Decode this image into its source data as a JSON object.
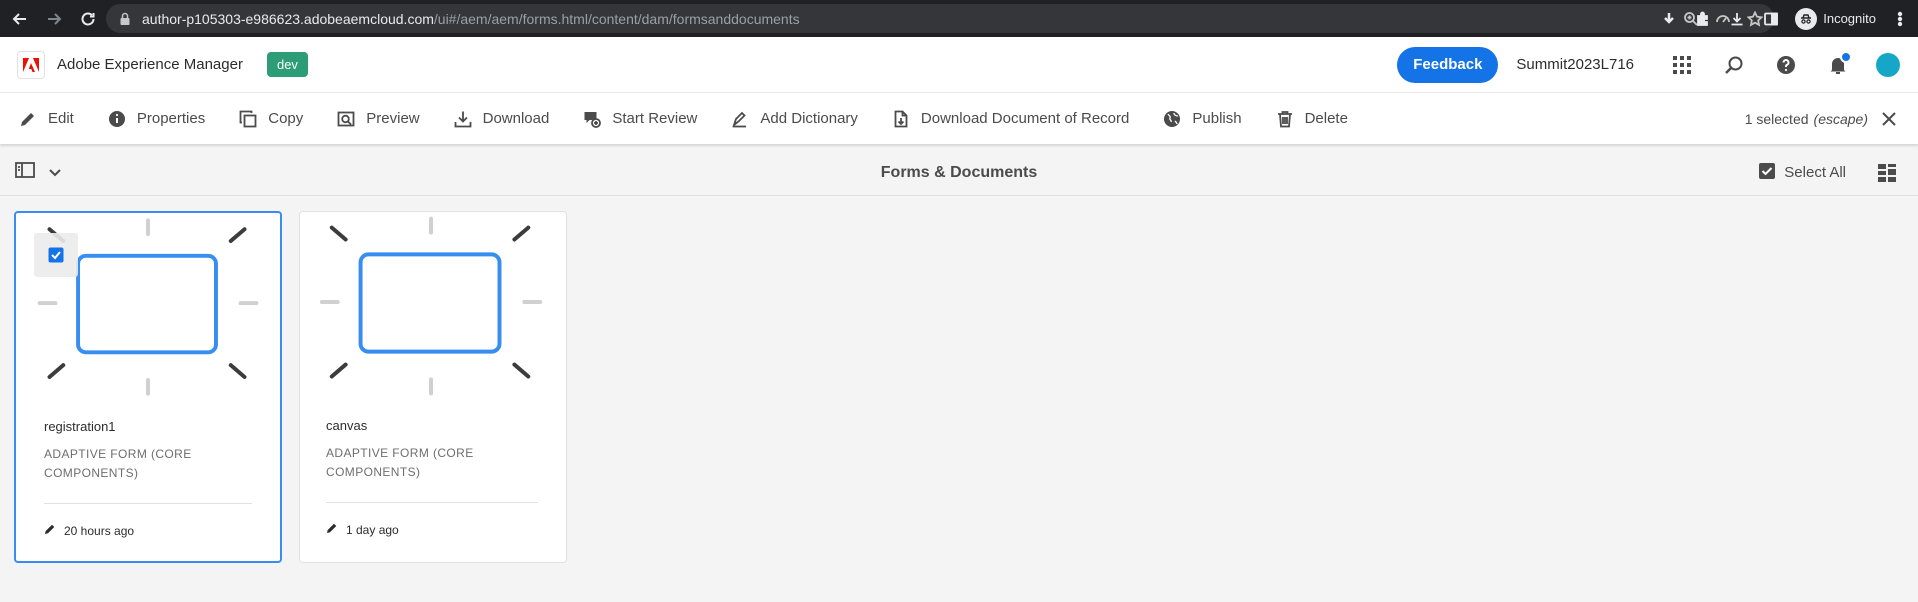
{
  "browser": {
    "url_host": "author-p105303-e986623.adobeaemcloud.com",
    "url_path": "/ui#/aem/aem/forms.html/content/dam/formsanddocuments",
    "profile_label": "Incognito"
  },
  "header": {
    "app_title": "Adobe Experience Manager",
    "env_badge": "dev",
    "feedback_label": "Feedback",
    "org_name": "Summit2023L716"
  },
  "actions": [
    {
      "label": "Edit",
      "icon": "pencil-icon"
    },
    {
      "label": "Properties",
      "icon": "info-icon"
    },
    {
      "label": "Copy",
      "icon": "copy-icon"
    },
    {
      "label": "Preview",
      "icon": "preview-icon"
    },
    {
      "label": "Download",
      "icon": "download-icon"
    },
    {
      "label": "Start Review",
      "icon": "review-icon"
    },
    {
      "label": "Add Dictionary",
      "icon": "dictionary-icon"
    },
    {
      "label": "Download Document of Record",
      "icon": "document-icon"
    },
    {
      "label": "Publish",
      "icon": "globe-icon"
    },
    {
      "label": "Delete",
      "icon": "trash-icon"
    }
  ],
  "selection": {
    "count_label": "1 selected",
    "hint": "(escape)"
  },
  "title_bar": {
    "title": "Forms & Documents",
    "select_all_label": "Select All"
  },
  "cards": [
    {
      "name": "registration1",
      "type": "ADAPTIVE FORM (CORE COMPONENTS)",
      "modified": "20 hours ago",
      "selected": true
    },
    {
      "name": "canvas",
      "type": "ADAPTIVE FORM (CORE COMPONENTS)",
      "modified": "1 day ago",
      "selected": false
    }
  ],
  "colors": {
    "accent": "#1473e6",
    "env_badge": "#2d9d78",
    "selection_border": "#378ef0"
  }
}
